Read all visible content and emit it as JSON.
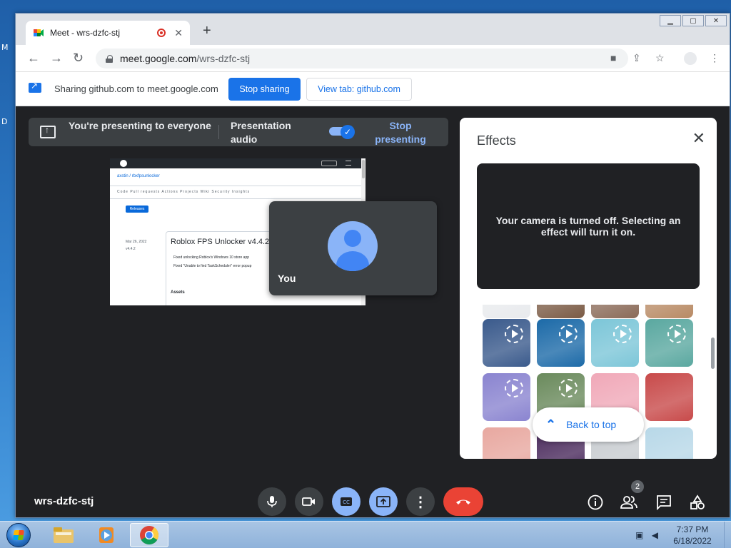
{
  "browser": {
    "tab_title": "Meet - wrs-dzfc-stj",
    "new_tab": "+",
    "tab_close": "✕",
    "url_host": "meet.google.com",
    "url_path": "/wrs-dzfc-stj"
  },
  "sharing_bar": {
    "text": "Sharing github.com to meet.google.com",
    "stop_label": "Stop sharing",
    "view_label": "View tab: github.com"
  },
  "meet": {
    "presenting_text": "You're presenting to everyone",
    "audio_label": "Presentation audio",
    "audio_toggle_on": true,
    "stop_presenting": "Stop presenting",
    "self_name": "You",
    "meeting_code": "wrs-dzfc-stj",
    "participant_count": "2"
  },
  "shared_page": {
    "repo": "axstin / rbxfpsunlocker",
    "nav": "Code  Pull requests  Actions  Projects  Wiki  Security  Insights",
    "releases_tab": "Releases",
    "release_title": "Roblox FPS Unlocker v4.4.2",
    "release_date": "Mar 26, 2022",
    "release_tag": "v4.4.2",
    "assets_label": "Assets",
    "bullet1": "Fixed unlocking Roblox's Windows 10 store app",
    "bullet2": "Fixed \"Unable to find TaskScheduler\" error popup"
  },
  "effects": {
    "title": "Effects",
    "camera_off_text": "Your camera is turned off. Selecting an effect will turn it on.",
    "back_to_top": "Back to top",
    "thumbnail_colors": [
      [
        "#e8eaed",
        "#7a5a44",
        "#8a6a58",
        "#b88a64"
      ],
      [
        "#3a5a8c",
        "#1c6aa8",
        "#7cc6d8",
        "#5aa8a0"
      ],
      [
        "#8a84d0",
        "#6a8a5c",
        "#f0a8b8",
        "#c84a4a"
      ],
      [
        "#e8a8a0",
        "#4a2a5c",
        "#c8ccd0",
        "#b8d8e8"
      ]
    ]
  },
  "taskbar": {
    "time": "7:37 PM",
    "date": "6/18/2022"
  }
}
